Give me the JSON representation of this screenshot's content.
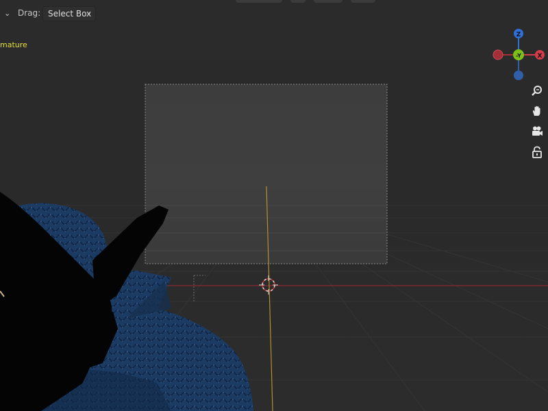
{
  "header": {
    "drag_label": "Drag:",
    "drag_value": "Select Box"
  },
  "viewport": {
    "object_info": "mature"
  },
  "gizmo": {
    "z_label": "Z",
    "x_label": "X",
    "y_label": "-Y",
    "colors": {
      "z": "#2f6fd6",
      "x": "#d43c4b",
      "y": "#7cc11a",
      "neg_x": "#a33039",
      "neg_z": "#2f5fa8"
    }
  },
  "tools": [
    {
      "name": "zoom-icon"
    },
    {
      "name": "pan-hand-icon"
    },
    {
      "name": "camera-icon"
    },
    {
      "name": "lock-icon"
    }
  ],
  "colors": {
    "x_axis_line": "#8a2a30",
    "y_axis_line": "#b6902e",
    "object_info_text": "#e4e03e",
    "mesh_blue": "#1b3a63"
  }
}
